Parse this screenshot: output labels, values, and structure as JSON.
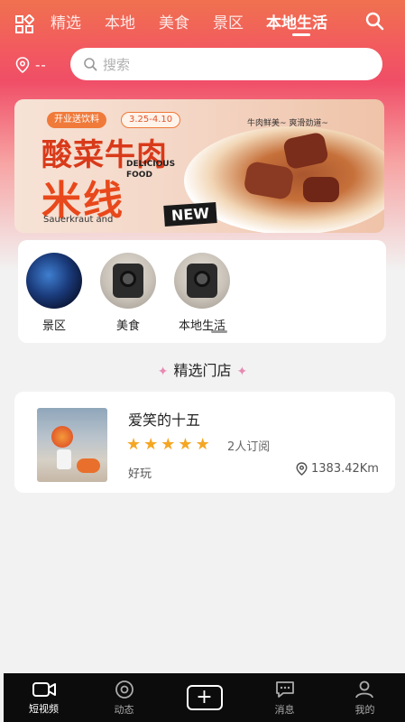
{
  "header": {
    "tabs": [
      {
        "label": "精选",
        "active": false
      },
      {
        "label": "本地",
        "active": false
      },
      {
        "label": "美食",
        "active": false
      },
      {
        "label": "景区",
        "active": false
      },
      {
        "label": "本地生活",
        "active": true
      }
    ]
  },
  "location": {
    "text": "--"
  },
  "search": {
    "placeholder": "搜索"
  },
  "banner": {
    "tag": "开业送饮料",
    "date": "3.25-4.10",
    "title_line1": "酸菜牛肉",
    "title_line2": "米线",
    "english": "DELICIOUS FOOD",
    "subtitle": "Sauerkraut and",
    "badge": "NEW",
    "bubble": "牛肉鲜美~ 爽滑劲道~"
  },
  "categories": [
    {
      "label": "景区",
      "icon": "earth-icon"
    },
    {
      "label": "美食",
      "icon": "projector-icon"
    },
    {
      "label": "本地生活",
      "icon": "projector-icon"
    }
  ],
  "section": {
    "title": "精选门店"
  },
  "stores": [
    {
      "name": "爱笑的十五",
      "rating": 5,
      "reviews": "2人订阅",
      "tag": "好玩",
      "distance": "1383.42Km"
    }
  ],
  "bottom_nav": [
    {
      "label": "短视频",
      "icon": "video-icon",
      "active": true
    },
    {
      "label": "动态",
      "icon": "dynamic-icon",
      "active": false
    },
    {
      "label": "",
      "icon": "plus-icon",
      "active": false
    },
    {
      "label": "消息",
      "icon": "message-icon",
      "active": false
    },
    {
      "label": "我的",
      "icon": "profile-icon",
      "active": false
    }
  ],
  "colors": {
    "accent": "#f04e67",
    "star": "#f5a623",
    "bar": "#0c0c0c"
  }
}
